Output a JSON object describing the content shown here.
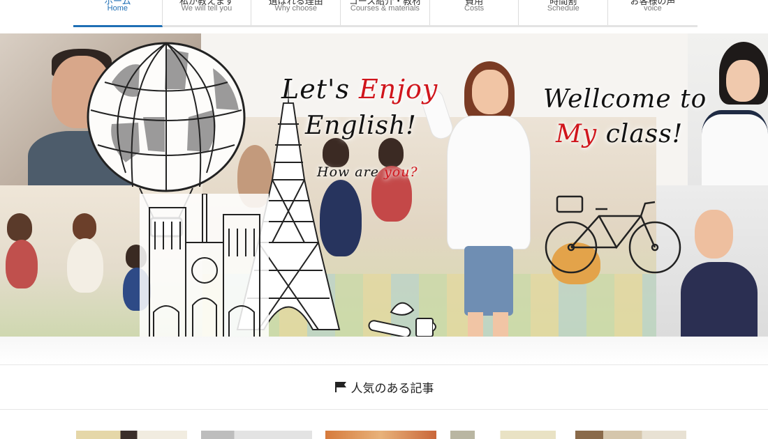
{
  "nav": {
    "items": [
      {
        "jp": "ホーム",
        "en": "Home",
        "active": true
      },
      {
        "jp": "私が教えます",
        "en": "We will tell you",
        "active": false
      },
      {
        "jp": "選ばれる理由",
        "en": "Why choose",
        "active": false
      },
      {
        "jp": "コース紹介・教材",
        "en": "Courses & materials",
        "active": false
      },
      {
        "jp": "費用",
        "en": "Costs",
        "active": false
      },
      {
        "jp": "時間割",
        "en": "Schedule",
        "active": false
      },
      {
        "jp": "お客様の声",
        "en": "voice",
        "active": false
      }
    ],
    "active_color": "#1f6fb5"
  },
  "hero": {
    "line1_a": "Let's ",
    "line1_b": "Enjoy",
    "line2": "English!",
    "how_a": "How are ",
    "how_b": "you?",
    "welcome": "Wellcome to",
    "my_a": "My",
    "my_b": " class!",
    "accent_red": "#d0151c"
  },
  "section": {
    "icon": "flag-icon",
    "title": "人気のある記事"
  },
  "thumbnails": [
    {
      "color": "#d8c79a"
    },
    {
      "color": "#bfbfbf"
    },
    {
      "color": "#d67a3c"
    },
    {
      "color": "#c9c7b5"
    },
    {
      "color": "#c3b29a"
    }
  ]
}
